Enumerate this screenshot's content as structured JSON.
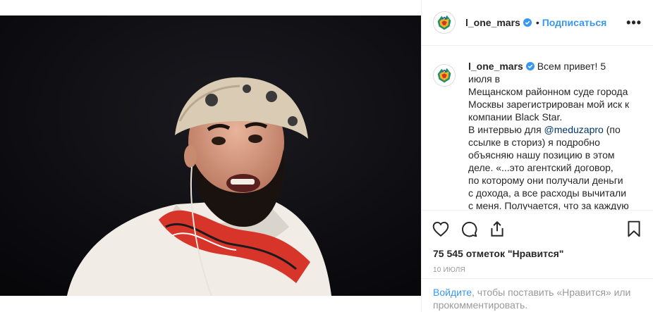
{
  "header": {
    "username": "l_one_mars",
    "dot": "•",
    "follow_label": "Подписаться",
    "more": "•••"
  },
  "caption": {
    "username": "l_one_mars",
    "lines": [
      "Всем привет! 5 июля в",
      "Мещанском районном суде города",
      "Москвы зарегистрирован мой иск к",
      "компании Black Star.",
      "В интервью для",
      "ссылке в сториз) я подробно",
      "объясняю нашу позицию в этом",
      "деле. «...это агентский договор,",
      "по которому они получали деньги",
      "с дохода, а все расходы вычитали",
      "с меня. Получается, что за каждую"
    ],
    "mention": "@meduzapro",
    "mention_after": " (по"
  },
  "actions": {
    "like_icon": "heart-icon",
    "comment_icon": "comment-icon",
    "share_icon": "share-icon",
    "save_icon": "bookmark-icon"
  },
  "likes_text": "75 545 отметок \"Нравится\"",
  "date_text": "10 ИЮЛЯ",
  "login": {
    "link": "Войдите",
    "rest": ", чтобы поставить «Нравится» или прокомментировать."
  },
  "colors": {
    "accent": "#3897f0",
    "mention": "#003569",
    "muted": "#999999",
    "verified": "#3897f0"
  }
}
